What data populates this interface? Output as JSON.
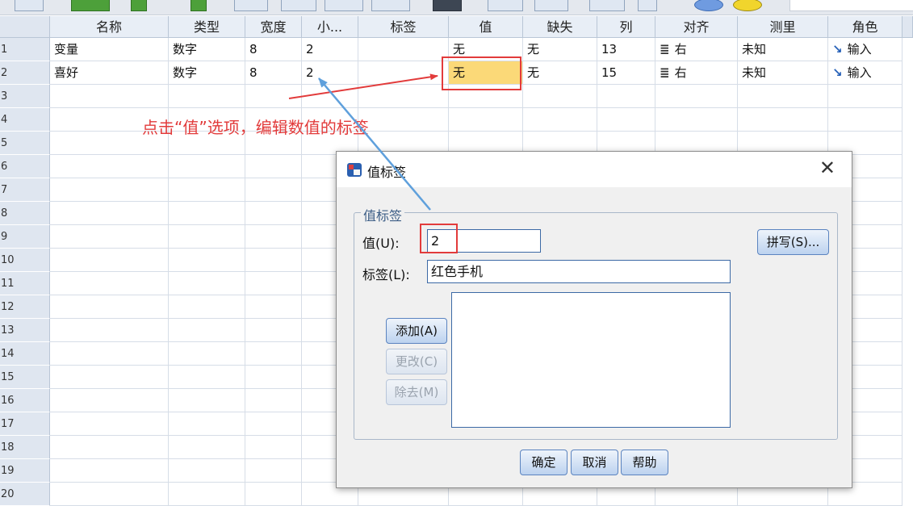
{
  "grid": {
    "headers": [
      "名称",
      "类型",
      "宽度",
      "小...",
      "标签",
      "值",
      "缺失",
      "列",
      "对齐",
      "测里",
      "角色"
    ],
    "row_numbers": [
      "1",
      "2",
      "3",
      "4",
      "5",
      "6",
      "7",
      "8",
      "9",
      "10",
      "11",
      "12",
      "13",
      "14",
      "15",
      "16",
      "17",
      "18",
      "19",
      "20"
    ],
    "rows": [
      {
        "name": "变量",
        "type": "数字",
        "width": "8",
        "decimals": "2",
        "label": "",
        "values": "无",
        "missing": "无",
        "columns": "13",
        "align": "右",
        "measure": "未知",
        "role": "输入"
      },
      {
        "name": "喜好",
        "type": "数字",
        "width": "8",
        "decimals": "2",
        "label": "",
        "values": "无",
        "missing": "无",
        "columns": "15",
        "align": "右",
        "measure": "未知",
        "role": "输入"
      }
    ]
  },
  "annotation": {
    "text": "点击“值”选项，编辑数值的标签",
    "color": "#e23b3b"
  },
  "dialog": {
    "title": "值标签",
    "close_glyph": "✕",
    "group_title": "值标签",
    "value_label": "值(U):",
    "value": "2",
    "label_label": "标签(L):",
    "label_value": "红色手机",
    "spelling_button": "拼写(S)...",
    "add_button": "添加(A)",
    "change_button": "更改(C)",
    "remove_button": "除去(M)",
    "ok_button": "确定",
    "cancel_button": "取消",
    "help_button": "帮助"
  },
  "icons": {
    "align": "align-right-icon",
    "role": "input-arrow-icon",
    "dialog": "value-labels-icon"
  },
  "colors": {
    "selected_cell": "#fbd978",
    "annotation_red": "#e23b3b",
    "arrow_blue": "#5fa0dc"
  }
}
